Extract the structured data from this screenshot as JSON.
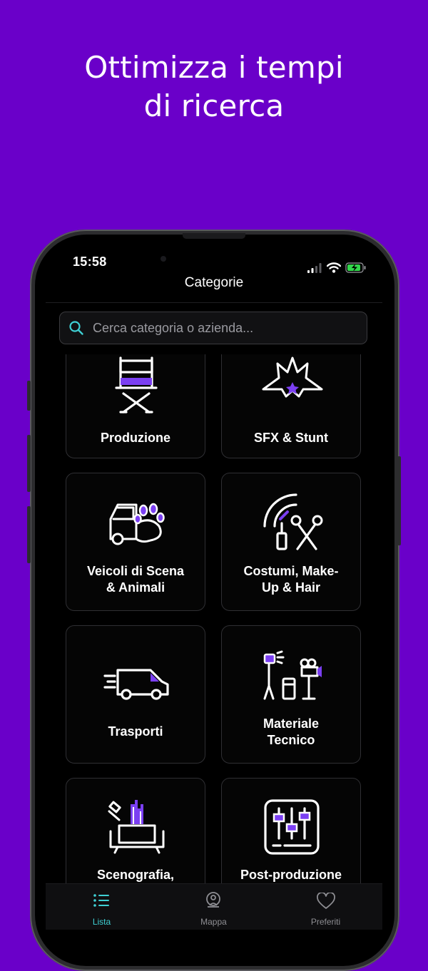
{
  "promo": {
    "line1": "Ottimizza i tempi",
    "line2": "di ricerca"
  },
  "status": {
    "time": "15:58",
    "battery": "charging"
  },
  "nav": {
    "title": "Categorie"
  },
  "search": {
    "placeholder": "Cerca categoria o azienda..."
  },
  "categories": [
    {
      "label_lines": [
        "Produzione"
      ],
      "icon": "director-chair-icon"
    },
    {
      "label_lines": [
        "SFX & Stunt"
      ],
      "icon": "explosion-star-icon"
    },
    {
      "label_lines": [
        "Veicoli di Scena",
        "& Animali"
      ],
      "icon": "car-paw-icon"
    },
    {
      "label_lines": [
        "Costumi, Make-",
        "Up & Hair"
      ],
      "icon": "makeup-scissors-icon"
    },
    {
      "label_lines": [
        "Trasporti"
      ],
      "icon": "delivery-van-icon"
    },
    {
      "label_lines": [
        "Materiale",
        "Tecnico"
      ],
      "icon": "light-camera-icon"
    },
    {
      "label_lines": [
        "Scenografia,"
      ],
      "icon": "set-design-icon"
    },
    {
      "label_lines": [
        "Post-produzione"
      ],
      "icon": "mixer-sliders-icon"
    }
  ],
  "tabs": [
    {
      "label": "Lista",
      "icon": "list-icon",
      "active": true
    },
    {
      "label": "Mappa",
      "icon": "map-icon",
      "active": false
    },
    {
      "label": "Preferiti",
      "icon": "heart-icon",
      "active": false
    }
  ],
  "colors": {
    "background": "#6a00c9",
    "accent": "#7b3ff2",
    "tab_active": "#3fd0d4",
    "tab_inactive": "#8e8e93"
  }
}
